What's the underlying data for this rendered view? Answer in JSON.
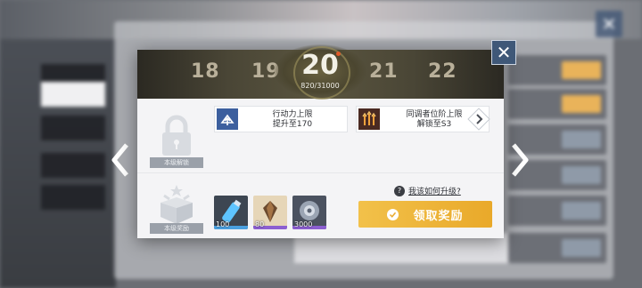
{
  "level_track": {
    "prev2": "18",
    "prev1": "19",
    "current": "20",
    "current_exp": "820/31000",
    "next1": "21",
    "next2": "22"
  },
  "unlock_section": {
    "label": "本级解锁",
    "items": [
      {
        "icon": "stamina-up-icon",
        "text": "行动力上限\n提升至170"
      },
      {
        "icon": "coordinator-rank-icon",
        "text": "同调者位阶上限\n解锁至S3"
      }
    ]
  },
  "reward_section": {
    "label": "本级奖励",
    "items": [
      {
        "icon": "energy-potion-icon",
        "count": "100"
      },
      {
        "icon": "crystal-icon",
        "count": "80"
      },
      {
        "icon": "chip-icon",
        "count": "3000"
      }
    ],
    "help_text": "我该如何升级?",
    "claim_label": "领取奖励"
  },
  "colors": {
    "accent_gold": "#f0b53a",
    "modal_bg": "#f4f4f6",
    "close_blue": "#3f5878",
    "nav_arrow": "#ffffff"
  }
}
